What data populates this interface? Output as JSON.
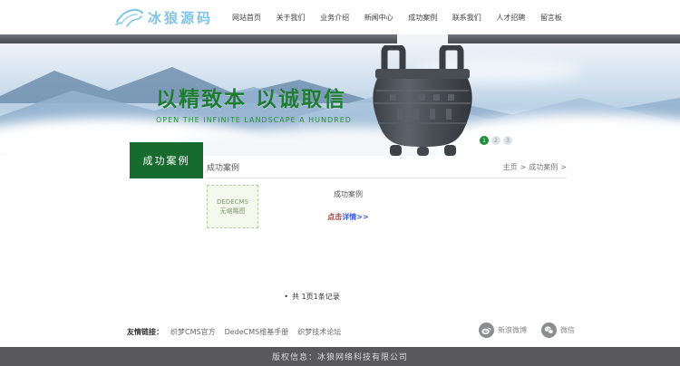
{
  "header": {
    "brand": "冰狼源码",
    "nav_items": [
      "网站首页",
      "关于我们",
      "业务介绍",
      "新闻中心",
      "成功案例",
      "联系我们",
      "人才招聘",
      "留言板"
    ],
    "active_item": "成功案例"
  },
  "hero": {
    "title": "以精致本 以诚取信",
    "subtitle": "OPEN THE INFINITE LANDSCAPE  A HUNDRED",
    "dots": [
      "1",
      "2",
      "3"
    ],
    "active_dot": "1"
  },
  "section": {
    "tab_label": "成功案例",
    "heading": "成功案例",
    "breadcrumb": {
      "home": "主页",
      "sep1": ">",
      "current": "成功案例",
      "sep2": ">"
    }
  },
  "case_list": {
    "item": {
      "thumb_line1": "DEDECMS",
      "thumb_line2": "无缩略图",
      "title": "成功案例",
      "link_click": "点击",
      "link_detail": "详情>>"
    },
    "pagination": {
      "bullet": "•",
      "text": "共 1页1条记录"
    }
  },
  "footer": {
    "links_label": "友情链接：",
    "links": [
      "织梦CMS官方",
      "DedeCMS维基手册",
      "织梦技术论坛"
    ],
    "social": [
      {
        "icon": "weibo-icon",
        "label": "新浪微博"
      },
      {
        "icon": "wechat-icon",
        "label": "微信"
      }
    ],
    "copyright": "版权信息：冰狼网络科技有限公司"
  },
  "colors": {
    "brand_blue": "#7fc3e8",
    "theme_green": "#176b2e",
    "hero_text_green": "#1f7d33",
    "link_blue": "#3c5bd6",
    "link_red": "#9b3b3b",
    "bar_gray": "#59595c"
  }
}
